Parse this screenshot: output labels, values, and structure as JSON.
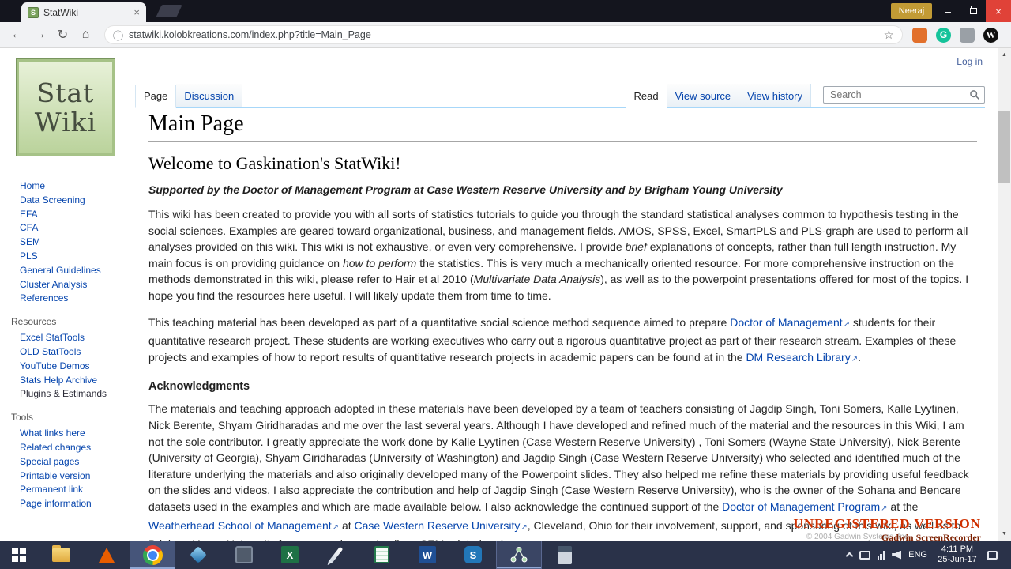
{
  "browser": {
    "tab_title": "StatWiki",
    "user_button": "Neeraj",
    "url": "statwiki.kolobkreations.com/index.php?title=Main_Page"
  },
  "wiki": {
    "login_label": "Log in",
    "logo_line1": "Stat",
    "logo_line2": "Wiki",
    "tabs": {
      "page": "Page",
      "discussion": "Discussion",
      "read": "Read",
      "view_source": "View source",
      "view_history": "View history"
    },
    "search_placeholder": "Search",
    "sidebar": {
      "main": [
        "Home",
        "Data Screening",
        "EFA",
        "CFA",
        "SEM",
        "PLS",
        "General Guidelines",
        "Cluster Analysis",
        "References"
      ],
      "resources_title": "Resources",
      "resources": [
        "Excel StatTools",
        "OLD StatTools",
        "YouTube Demos",
        "Stats Help Archive",
        "Plugins & Estimands"
      ],
      "tools_title": "Tools",
      "tools": [
        "What links here",
        "Related changes",
        "Special pages",
        "Printable version",
        "Permanent link",
        "Page information"
      ]
    },
    "article": {
      "title": "Main Page",
      "welcome": "Welcome to Gaskination's StatWiki!",
      "supported": "Supported by the Doctor of Management Program at Case Western Reserve University and by Brigham Young University",
      "p1": {
        "s1": "This wiki has been created to provide you with all sorts of statistics tutorials to guide you through the standard statistical analyses common to hypothesis testing in the social sciences. Examples are geared toward organizational, business, and management fields. AMOS, SPSS, Excel, SmartPLS and PLS-graph are used to perform all analyses provided on this wiki. This wiki is not exhaustive, or even very comprehensive. I provide ",
        "i1": "brief",
        "s2": " explanations of concepts, rather than full length instruction. My main focus is on providing guidance on ",
        "i2": "how to perform",
        "s3": " the statistics. This is very much a mechanically oriented resource. For more comprehensive instruction on the methods demonstrated in this wiki, please refer to Hair et al 2010 (",
        "i3": "Multivariate Data Analysis",
        "s4": "), as well as to the powerpoint presentations offered for most of the topics. I hope you find the resources here useful. I will likely update them from time to time."
      },
      "p2": {
        "s1": "This teaching material has been developed as part of a quantitative social science method sequence aimed to prepare ",
        "l1": "Doctor of Management",
        "s2": " students for their quantitative research project. These students are working executives who carry out a rigorous quantitative project as part of their research stream. Examples of these projects and examples of how to report results of quantitative research projects in academic papers can be found at in the ",
        "l2": "DM Research Library",
        "s3": "."
      },
      "ack_title": "Acknowledgments",
      "ack": {
        "s1": "The materials and teaching approach adopted in these materials have been developed by a team of teachers consisting of Jagdip Singh, Toni Somers, Kalle Lyytinen, Nick Berente, Shyam Giridharadas and me over the last several years. Although I have developed and refined much of the material and the resources in this Wiki, I am not the sole contributor. I greatly appreciate the work done by Kalle Lyytinen (Case Western Reserve University) , Toni Somers (Wayne State University), Nick Berente (University of Georgia), Shyam Giridharadas (University of Washington) and Jagdip Singh (Case Western Reserve University) who selected and identified much of the literature underlying the materials and also originally developed many of the Powerpoint slides. They also helped me refine these materials by providing useful feedback on the slides and videos. I also appreciate the contribution and help of Jagdip Singh (Case Western Reserve University), who is the owner of the Sohana and Bencare datasets used in the examples and which are made available below. I also acknowledge the continued support of the ",
        "l1": "Doctor of Management Program",
        "s2": " at the ",
        "l2": "Weatherhead School of Management",
        "s3": " at ",
        "l3": "Case Western Reserve University",
        "s4": ", Cleveland, Ohio for their involvement, support, and sponsoring of this wiki, as well as to Brigham Young University for encouraging me in all my SEM-related endeavors."
      }
    }
  },
  "watermark": {
    "line1": "UNREGISTERED VERSION",
    "line2": "© 2004 Gadwin Systems, Inc",
    "line3": "Gadwin ScreenRecorder"
  },
  "taskbar": {
    "lang": "ENG",
    "time": "4:11 PM",
    "date": "25-Jun-17"
  },
  "colors": {
    "link_blue": "#0645ad",
    "tab_border_blue": "#a7d7f9",
    "watermark_red": "#cf3000",
    "taskbar_bg": "#2a3249",
    "logo_green": "#b9d29a"
  },
  "glyphs": {
    "back": "←",
    "forward": "→",
    "reload": "↻",
    "home": "⌂",
    "info": "ⓘ",
    "star": "☆",
    "close": "×",
    "minimize": "–",
    "favicon_letter": "S",
    "ext_g": "G",
    "ext_w": "W",
    "excel_letter": "X",
    "word_letter": "W",
    "spss_letter": "S",
    "sb_up": "▲",
    "sb_down": "▼"
  }
}
